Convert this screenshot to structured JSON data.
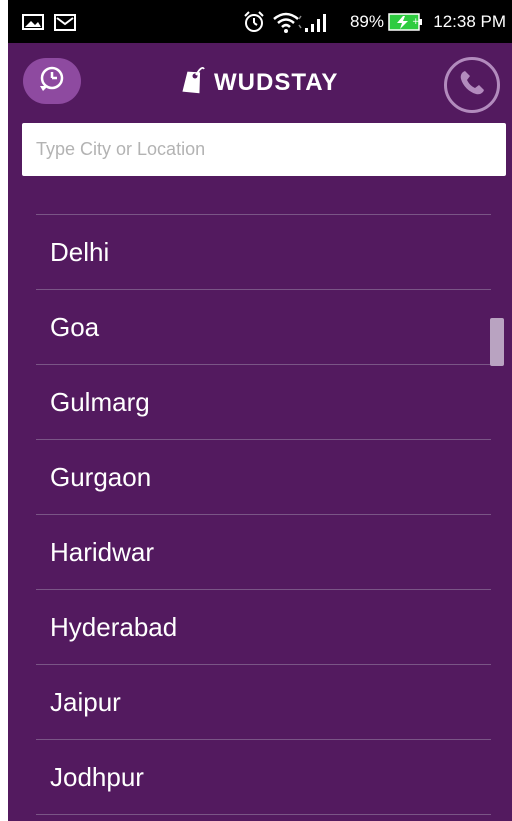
{
  "status_bar": {
    "battery": "89%",
    "time": "12:38 PM",
    "icons": [
      "image-icon",
      "mail-icon",
      "alarm-icon",
      "wifi-icon",
      "signal-icon",
      "battery-charging-icon"
    ]
  },
  "app_bar": {
    "brand": "WUDSTAY",
    "left_button_icon": "history-icon",
    "right_button_icon": "phone-icon"
  },
  "search": {
    "placeholder": "Type City or Location",
    "value": ""
  },
  "cities": [
    "Delhi",
    "Goa",
    "Gulmarg",
    "Gurgaon",
    "Haridwar",
    "Hyderabad",
    "Jaipur",
    "Jodhpur"
  ],
  "colors": {
    "background": "#531a5f",
    "accent": "#8e4aa0",
    "divider": "#7a5586"
  }
}
